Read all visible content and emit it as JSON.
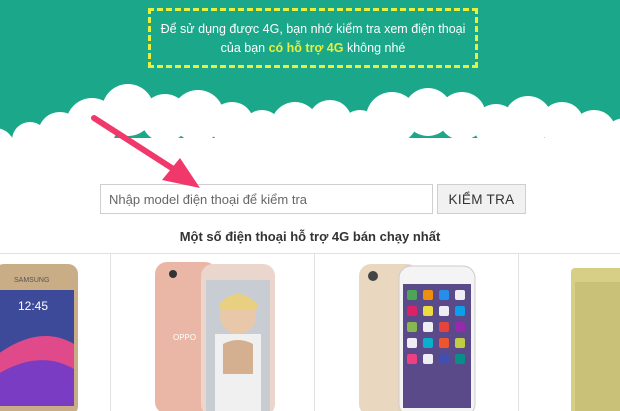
{
  "notice": {
    "line1": "Để sử dụng được 4G, bạn nhớ kiểm tra xem điện thoại",
    "line2_prefix": "của bạn ",
    "line2_highlight": "có hỗ trợ 4G",
    "line2_suffix": " không nhé"
  },
  "search": {
    "placeholder": "Nhập model điện thoại để kiểm tra",
    "value": "",
    "button_label": "KIỂM TRA"
  },
  "section": {
    "title": "Một số điện thoại hỗ trợ 4G bán chạy nhất"
  },
  "phones": [
    {
      "brand_text": "SAMSUNG",
      "screen_time": "12:45"
    },
    {
      "brand_text": "OPPO"
    },
    {
      "brand_text": ""
    },
    {
      "brand_text": ""
    }
  ],
  "colors": {
    "banner": "#1aa78a",
    "highlight": "#e9ef3a",
    "arrow": "#f0386b"
  }
}
